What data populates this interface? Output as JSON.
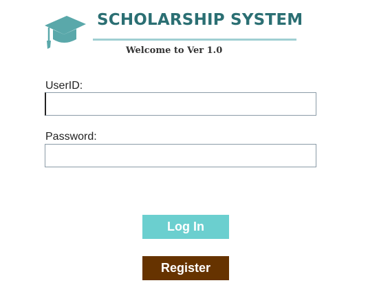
{
  "header": {
    "icon": "graduation-cap-icon",
    "title": "SCHOLARSHIP SYSTEM",
    "subtitle": "Welcome to Ver 1.0"
  },
  "form": {
    "userid_label": "UserID:",
    "userid_value": "",
    "password_label": "Password:",
    "password_value": ""
  },
  "buttons": {
    "login_label": "Log In",
    "register_label": "Register"
  },
  "colors": {
    "title": "#2b6f73",
    "title_rule": "#9fcfd2",
    "logo": "#5aa8aa",
    "login_button": "#6bcfcf",
    "register_button": "#663300"
  }
}
